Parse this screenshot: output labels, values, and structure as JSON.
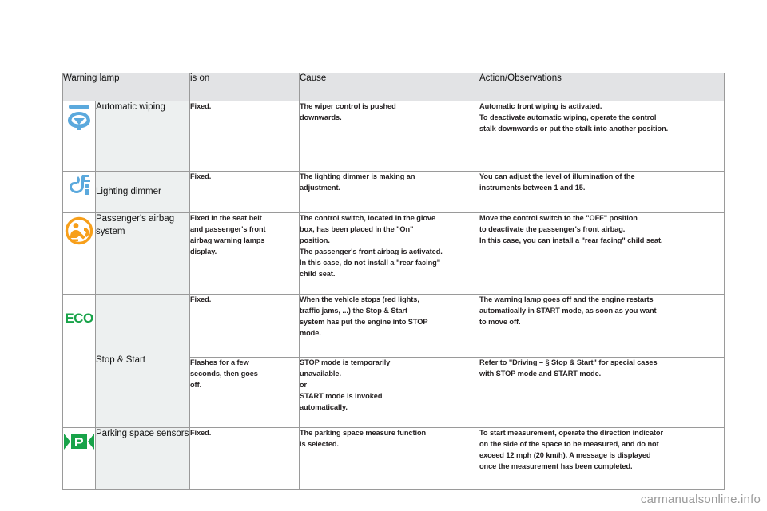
{
  "table": {
    "headers": [
      "Warning lamp",
      "is on",
      "Cause",
      "Action/Observations"
    ],
    "rows": [
      {
        "icon": "automatic-wiping-icon",
        "icon_color": "#5ba9dd",
        "lamp": "Automatic wiping",
        "is_on": "Fixed.",
        "cause": [
          "The wiper control is pushed",
          "downwards."
        ],
        "action": [
          "Automatic front wiping is activated.",
          "To deactivate automatic wiping, operate the control",
          "stalk downwards or put the stalk into another position."
        ]
      },
      {
        "icon": "lighting-dimmer-icon",
        "icon_color": "#5ba9dd",
        "lamp": "Lighting dimmer",
        "is_on": "Fixed.",
        "cause": [
          "The lighting dimmer is making an",
          "adjustment."
        ],
        "action": [
          "You can adjust the level of illumination of the",
          "instruments between 1 and 15."
        ]
      },
      {
        "icon": "passenger-airbag-icon",
        "icon_color": "#f79f1a",
        "lamp": "Passenger's airbag system",
        "is_on": [
          "Fixed in the seat belt",
          "and passenger's front",
          "airbag warning lamps",
          "display."
        ],
        "cause": [
          "The control switch, located in the glove",
          "box, has been placed in the \"On\"",
          "position.",
          "The passenger's front airbag is activated.",
          "In this case, do not install a \"rear facing\"",
          "child seat."
        ],
        "action": [
          "Move the control switch to the \"OFF\" position",
          "to deactivate the passenger's front airbag.",
          "In this case, you can install a \"rear facing\" child seat."
        ]
      },
      {
        "icon": "eco-stop-start-icon",
        "icon_color": "#18a349",
        "icon_text": "ECO",
        "lamp": "Stop & Start",
        "subrows": [
          {
            "is_on": "Fixed.",
            "cause": [
              "When the vehicle stops (red lights,",
              "traffic jams, ...) the Stop & Start",
              "system has put the engine into STOP",
              "mode."
            ],
            "action": [
              "The warning lamp goes off and the engine restarts",
              "automatically in START mode, as soon as you want",
              "to move off."
            ]
          },
          {
            "is_on": [
              "Flashes for a few",
              "seconds, then goes",
              "off."
            ],
            "cause": [
              "STOP mode is temporarily",
              "unavailable.",
              "or",
              "START mode is invoked",
              "automatically."
            ],
            "action": [
              "Refer to \"Driving – § Stop & Start\" for special cases",
              "with STOP mode and START mode."
            ]
          }
        ]
      },
      {
        "icon": "parking-space-sensors-icon",
        "icon_color": "#18a349",
        "lamp": "Parking space sensors",
        "is_on": "Fixed.",
        "cause": [
          "The parking space measure function",
          "is selected."
        ],
        "action": [
          "To start measurement, operate the direction indicator",
          "on the side of the space to be measured, and do not",
          "exceed 12 mph (20 km/h). A message is displayed",
          "once the measurement has been completed."
        ]
      }
    ]
  },
  "watermark": "carmanualsonline.info"
}
